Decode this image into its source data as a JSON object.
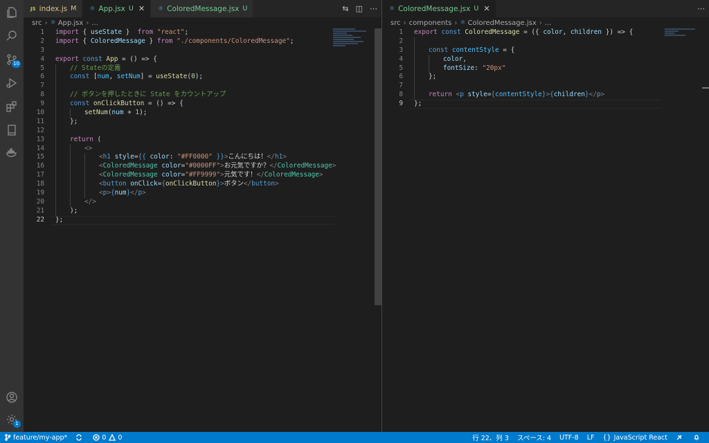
{
  "left_group": {
    "tabs": [
      {
        "icon": "JS",
        "label": "index.js",
        "status": "M"
      },
      {
        "label": "App.jsx",
        "status": "U"
      },
      {
        "label": "ColoredMessage.jsx",
        "status": "U"
      }
    ],
    "breadcrumb": [
      "src",
      "App.jsx",
      "..."
    ],
    "lines": [
      {
        "n": "1"
      },
      {
        "n": "2"
      },
      {
        "n": "3"
      },
      {
        "n": "4"
      },
      {
        "n": "5"
      },
      {
        "n": "6"
      },
      {
        "n": "7"
      },
      {
        "n": "8"
      },
      {
        "n": "9"
      },
      {
        "n": "10"
      },
      {
        "n": "11"
      },
      {
        "n": "12"
      },
      {
        "n": "13"
      },
      {
        "n": "14"
      },
      {
        "n": "15"
      },
      {
        "n": "16"
      },
      {
        "n": "17"
      },
      {
        "n": "18"
      },
      {
        "n": "19"
      },
      {
        "n": "20"
      },
      {
        "n": "21"
      },
      {
        "n": "22"
      }
    ],
    "code": {
      "l1": [
        "import",
        "{",
        "useState",
        "}",
        "from",
        "\"react\"",
        ";"
      ],
      "l2": [
        "import",
        "{",
        "ColoredMessage",
        "}",
        "from",
        "\"./components/ColoredMessage\"",
        ";"
      ],
      "l4": [
        "export",
        "const",
        "App",
        "= () => {"
      ],
      "l5": "// Stateの定義",
      "l6": [
        "const",
        "[",
        "num",
        ",",
        "setNum",
        "] =",
        "useState",
        "(",
        "0",
        ");"
      ],
      "l8": "// ボタンを押したときに State をカウントアップ",
      "l9": [
        "const",
        "onClickButton",
        "= () => {"
      ],
      "l10": [
        "setNum",
        "(",
        "num",
        " + ",
        "1",
        ");"
      ],
      "l11": "};",
      "l13": [
        "return",
        " ("
      ],
      "l14": "<>",
      "l15": [
        "<",
        "h1",
        "style",
        "=",
        "{{",
        "color",
        ": ",
        "\"#FF0000\"",
        " }}",
        ">",
        "こんにちは！",
        "</",
        "h1",
        ">"
      ],
      "l16": [
        "<",
        "ColoredMessage",
        "color",
        "=",
        "\"#0000FF\"",
        ">",
        "お元気ですか？",
        "</",
        "ColoredMessage",
        ">"
      ],
      "l17": [
        "<",
        "ColoredMessage",
        "color",
        "=",
        "\"#FF9999\"",
        ">",
        "元気です！",
        "</",
        "ColoredMessage",
        ">"
      ],
      "l18": [
        "<",
        "button",
        "onClick",
        "=",
        "{",
        "onClickButton",
        "}",
        ">",
        "ボタン",
        "</",
        "button",
        ">"
      ],
      "l19": [
        "<",
        "p",
        ">",
        "{",
        "num",
        "}",
        "</",
        "p",
        ">"
      ],
      "l20": "</>",
      "l21": ");",
      "l22": "};"
    }
  },
  "right_group": {
    "tabs": [
      {
        "label": "ColoredMessage.jsx",
        "status": "U"
      }
    ],
    "breadcrumb": [
      "src",
      "components",
      "ColoredMessage.jsx",
      "..."
    ],
    "lines": [
      {
        "n": "1"
      },
      {
        "n": "2"
      },
      {
        "n": "3"
      },
      {
        "n": "4"
      },
      {
        "n": "5"
      },
      {
        "n": "6"
      },
      {
        "n": "7"
      },
      {
        "n": "8"
      },
      {
        "n": "9"
      }
    ],
    "code": {
      "l1": [
        "export",
        "const",
        "ColoredMessage",
        "= ({",
        "color",
        ",",
        "children",
        "}) => {"
      ],
      "l3": [
        "const",
        "contentStyle",
        "= {"
      ],
      "l4": [
        "color",
        ","
      ],
      "l5": [
        "fontSize",
        ": ",
        "\"20px\""
      ],
      "l6": "};",
      "l8": [
        "return",
        "<",
        "p",
        "style",
        "=",
        "{",
        "contentStyle",
        "}",
        ">",
        "{",
        "children",
        "}",
        "</",
        "p",
        ">"
      ],
      "l9": "};"
    }
  },
  "activity_bar": {
    "scm_badge": "10",
    "settings_badge": "1"
  },
  "status_bar": {
    "branch": "feature/my-app*",
    "errors": "0",
    "warnings": "0",
    "cursor": "行 22、列 3",
    "indent": "スペース: 4",
    "encoding": "UTF-8",
    "eol": "LF",
    "language": "JavaScript React"
  },
  "colors": {
    "accent": "#007acc",
    "editor_bg": "#1e1e1e",
    "activity_bg": "#333333"
  }
}
